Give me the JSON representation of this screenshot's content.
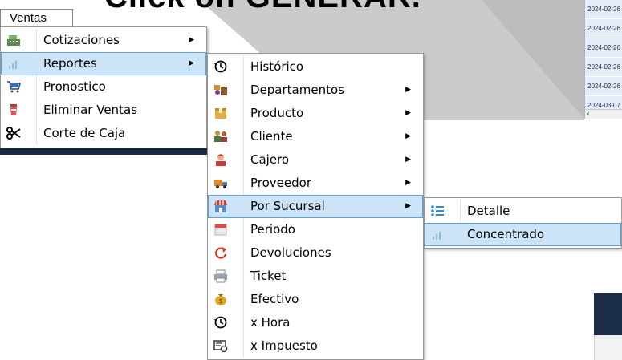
{
  "background": {
    "banner_text": "Click on GENERAR.",
    "dates": [
      "2024-02-26",
      "2024-02-26",
      "2024-02-26",
      "2024-02-26",
      "2024-02-26",
      "2024-03-07"
    ],
    "scroll_glyph": "‹"
  },
  "menubar": {
    "ventas": "Ventas"
  },
  "ventas_menu": [
    {
      "label": "Cotizaciones",
      "icon": "cash-register-icon",
      "submenu": true
    },
    {
      "label": "Reportes",
      "icon": "bar-chart-icon",
      "submenu": true,
      "highlighted": true
    },
    {
      "label": "Pronostico",
      "icon": "shopping-cart-icon",
      "submenu": false
    },
    {
      "label": "Eliminar Ventas",
      "icon": "trash-cup-icon",
      "submenu": false
    },
    {
      "label": "Corte de Caja",
      "icon": "scissors-icon",
      "submenu": false
    }
  ],
  "reportes_menu": [
    {
      "label": "Histórico",
      "icon": "history-clock-icon",
      "submenu": false
    },
    {
      "label": "Departamentos",
      "icon": "departments-icon",
      "submenu": true
    },
    {
      "label": "Producto",
      "icon": "product-box-icon",
      "submenu": true
    },
    {
      "label": "Cliente",
      "icon": "customers-icon",
      "submenu": true
    },
    {
      "label": "Cajero",
      "icon": "cashier-icon",
      "submenu": true
    },
    {
      "label": "Proveedor",
      "icon": "supplier-truck-icon",
      "submenu": true
    },
    {
      "label": "Por Sucursal",
      "icon": "store-icon",
      "submenu": true,
      "highlighted": true
    },
    {
      "label": "Periodo",
      "icon": "calendar-icon",
      "submenu": false
    },
    {
      "label": "Devoluciones",
      "icon": "refresh-arrow-icon",
      "submenu": false
    },
    {
      "label": "Ticket",
      "icon": "printer-icon",
      "submenu": false
    },
    {
      "label": "Efectivo",
      "icon": "money-bag-icon",
      "submenu": false
    },
    {
      "label": "x Hora",
      "icon": "history-clock-icon",
      "submenu": false
    },
    {
      "label": "x Impuesto",
      "icon": "tax-icon",
      "submenu": false
    }
  ],
  "sucursal_menu": [
    {
      "label": "Detalle",
      "icon": "list-icon",
      "submenu": false
    },
    {
      "label": "Concentrado",
      "icon": "bar-chart-icon",
      "submenu": false,
      "highlighted": true
    }
  ],
  "arrow_glyph": "▶",
  "colors": {
    "highlight_bg": "#cce4f7",
    "highlight_border": "#5ea1d8",
    "dark_navy": "#1b2c46"
  }
}
